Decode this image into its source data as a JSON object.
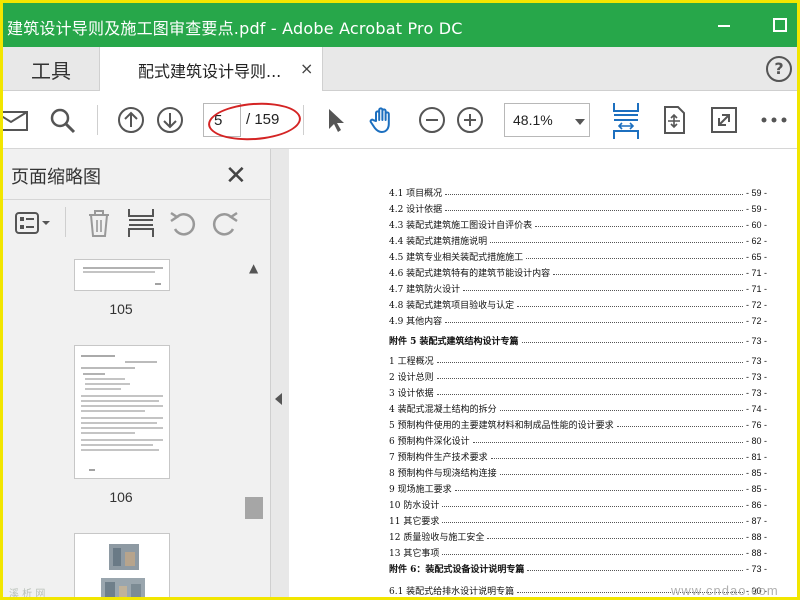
{
  "window": {
    "title": "建筑设计导则及施工图审查要点.pdf - Adobe Acrobat Pro DC"
  },
  "tabs": {
    "tools_label": "工具",
    "document_label": "配式建筑设计导则...",
    "close_symbol": "×",
    "help_symbol": "?"
  },
  "toolbar": {
    "page_current": "5",
    "page_total": "/ 159",
    "zoom_value": "48.1%"
  },
  "sidebar": {
    "title": "页面缩略图",
    "close_symbol": "✕",
    "thumbnails": [
      {
        "page": "105"
      },
      {
        "page": "106"
      }
    ]
  },
  "toc": [
    {
      "label": "4.1 项目概况",
      "page": "- 59 -",
      "bold": false
    },
    {
      "label": "4.2 设计依据",
      "page": "- 59 -",
      "bold": false
    },
    {
      "label": "4.3 装配式建筑施工图设计自评价表",
      "page": "- 60 -",
      "bold": false
    },
    {
      "label": "4.4 装配式建筑措施说明",
      "page": "- 62 -",
      "bold": false
    },
    {
      "label": "4.5 建筑专业相关装配式措施施工",
      "page": "- 65 -",
      "bold": false
    },
    {
      "label": "4.6 装配式建筑特有的建筑节能设计内容",
      "page": "- 71 -",
      "bold": false
    },
    {
      "label": "4.7 建筑防火设计",
      "page": "- 71 -",
      "bold": false
    },
    {
      "label": "4.8 装配式建筑项目验收与认定",
      "page": "- 72 -",
      "bold": false
    },
    {
      "label": "4.9 其他内容",
      "page": "- 72 -",
      "bold": false
    },
    {
      "label": "附件 5 装配式建筑结构设计专篇",
      "page": "- 73 -",
      "bold": true
    },
    {
      "label": "1 工程概况",
      "page": "- 73 -",
      "bold": false
    },
    {
      "label": "2 设计总则",
      "page": "- 73 -",
      "bold": false
    },
    {
      "label": "3 设计依据",
      "page": "- 73 -",
      "bold": false
    },
    {
      "label": "4 装配式混凝土结构的拆分",
      "page": "- 74 -",
      "bold": false
    },
    {
      "label": "5 预制构件使用的主要建筑材料和制成品性能的设计要求",
      "page": "- 76 -",
      "bold": false
    },
    {
      "label": "6 预制构件深化设计",
      "page": "- 80 -",
      "bold": false
    },
    {
      "label": "7 预制构件生产技术要求",
      "page": "- 81 -",
      "bold": false
    },
    {
      "label": "8 预制构件与现浇结构连接",
      "page": "- 85 -",
      "bold": false
    },
    {
      "label": "9 现场施工要求",
      "page": "- 85 -",
      "bold": false
    },
    {
      "label": "10 防水设计",
      "page": "- 86 -",
      "bold": false
    },
    {
      "label": "11 其它要求",
      "page": "- 87 -",
      "bold": false
    },
    {
      "label": "12 质量验收与施工安全",
      "page": "- 88 -",
      "bold": false
    },
    {
      "label": "13 其它事项",
      "page": "- 88 -",
      "bold": false
    },
    {
      "label": "附件 6：装配式设备设计说明专篇",
      "page": "- 73 -",
      "bold": true
    },
    {
      "label": "6.1 装配式给排水设计说明专篇",
      "page": "- 90 -",
      "bold": false
    }
  ],
  "watermarks": {
    "left": "溪 析 网",
    "right": "www.cndao.com"
  },
  "colors": {
    "titlebar": "#27a74a",
    "accent": "#1c6fbf",
    "annotation": "#d42424"
  }
}
